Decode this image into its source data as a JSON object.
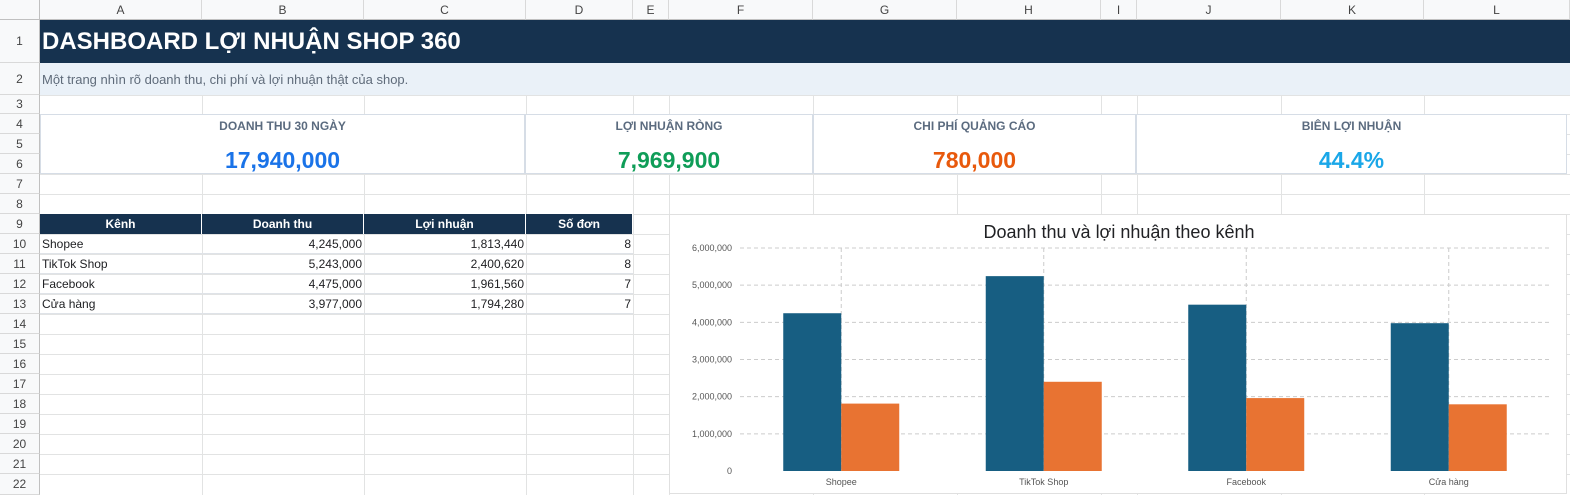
{
  "columns": [
    "A",
    "B",
    "C",
    "D",
    "E",
    "F",
    "G",
    "H",
    "I",
    "J",
    "K",
    "L"
  ],
  "rows": [
    "1",
    "2",
    "3",
    "4",
    "5",
    "6",
    "7",
    "8",
    "9",
    "10",
    "11",
    "12",
    "13",
    "14",
    "15",
    "16",
    "17",
    "18",
    "19",
    "20",
    "21",
    "22"
  ],
  "header": {
    "title": "DASHBOARD LỢI NHUẬN SHOP 360",
    "subtitle": "Một trang nhìn rõ doanh thu, chi phí và lợi nhuận thật của shop."
  },
  "kpis": [
    {
      "label": "DOANH THU 30 NGÀY",
      "value": "17,940,000",
      "color": "#1a73e8"
    },
    {
      "label": "LỢI NHUẬN RÒNG",
      "value": "7,969,900",
      "color": "#0f9d58"
    },
    {
      "label": "CHI PHÍ QUẢNG CÁO",
      "value": "780,000",
      "color": "#e8590c"
    },
    {
      "label": "BIÊN LỢI NHUẬN",
      "value": "44.4%",
      "color": "#1aa7e8"
    }
  ],
  "table": {
    "headers": [
      "Kênh",
      "Doanh thu",
      "Lợi nhuận",
      "Số đơn"
    ],
    "rows": [
      [
        "Shopee",
        "4,245,000",
        "1,813,440",
        "8"
      ],
      [
        "TikTok Shop",
        "5,243,000",
        "2,400,620",
        "8"
      ],
      [
        "Facebook",
        "4,475,000",
        "1,961,560",
        "7"
      ],
      [
        "Cửa hàng",
        "3,977,000",
        "1,794,280",
        "7"
      ]
    ]
  },
  "chart_data": {
    "type": "bar",
    "title": "Doanh thu và lợi nhuận theo kênh",
    "categories": [
      "Shopee",
      "TikTok Shop",
      "Facebook",
      "Cửa hàng"
    ],
    "series": [
      {
        "values": [
          4245000,
          5243000,
          4475000,
          3977000
        ],
        "color": "#175e82"
      },
      {
        "values": [
          1813440,
          2400620,
          1961560,
          1794280
        ],
        "color": "#e87332"
      }
    ],
    "ylim": [
      0,
      6000000
    ],
    "yticks": [
      "0",
      "1,000,000",
      "2,000,000",
      "3,000,000",
      "4,000,000",
      "5,000,000",
      "6,000,000"
    ],
    "grid": true
  }
}
